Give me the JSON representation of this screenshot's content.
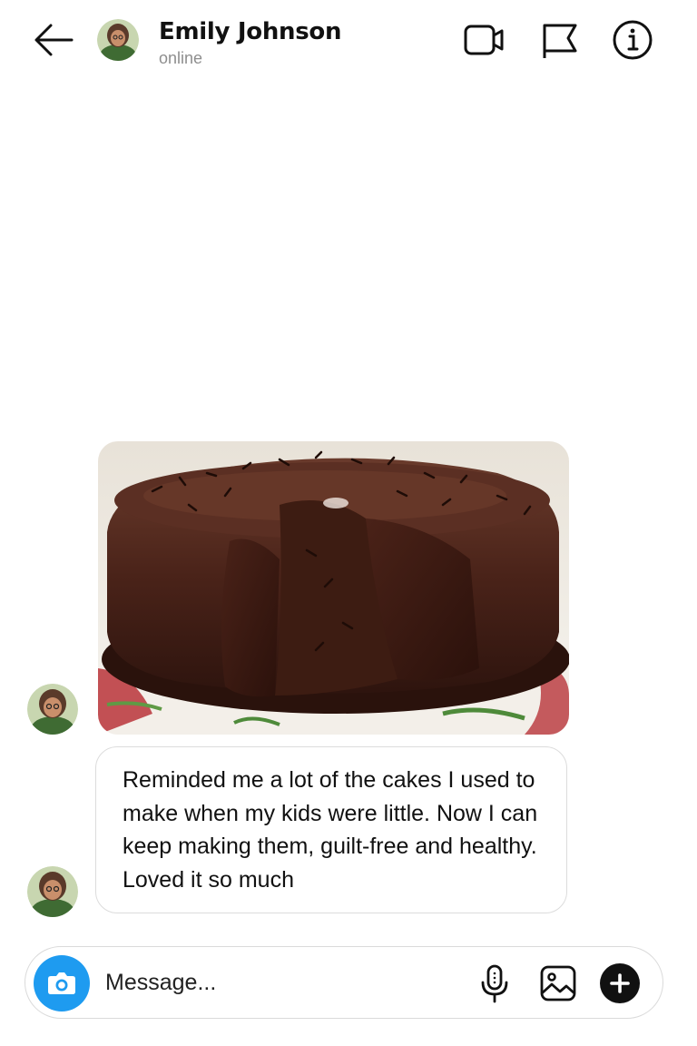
{
  "header": {
    "contact_name": "Emily Johnson",
    "status": "online",
    "icons": {
      "back": "arrow-left-icon",
      "video": "video-camera-icon",
      "flag": "flag-icon",
      "info": "info-icon"
    }
  },
  "conversation": {
    "messages": [
      {
        "type": "image",
        "description_icon": "chocolate-cake-photo"
      },
      {
        "type": "text",
        "text": "Reminded me a lot of the cakes I used to make when my kids were little. Now I can keep making them, guilt-free and healthy. Loved it so much"
      }
    ]
  },
  "composer": {
    "placeholder": "Message...",
    "value": "",
    "icons": {
      "camera": "camera-icon",
      "mic": "microphone-icon",
      "gallery": "image-icon",
      "plus": "plus-icon"
    },
    "colors": {
      "camera_button": "#1e9bf0",
      "plus_button": "#111111"
    }
  }
}
